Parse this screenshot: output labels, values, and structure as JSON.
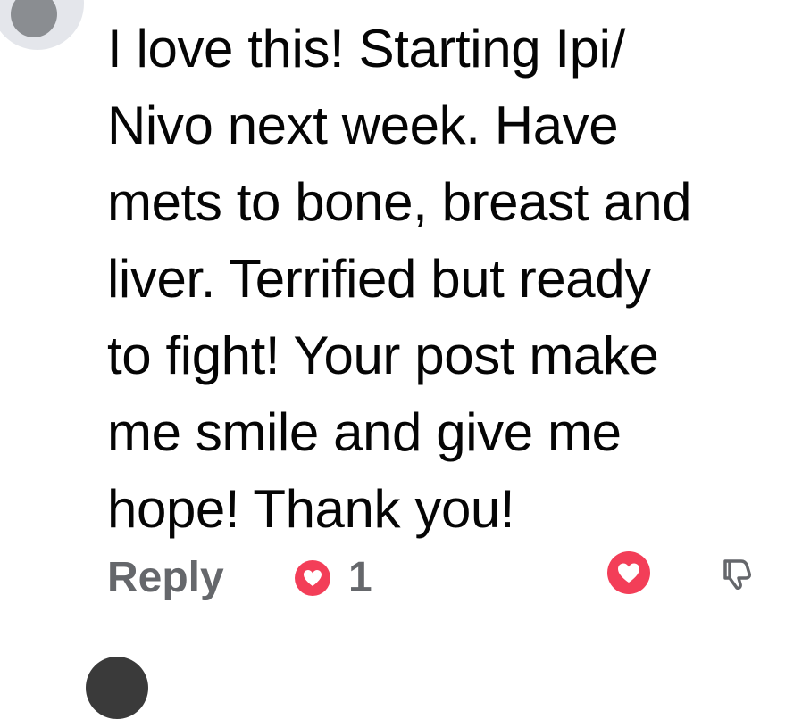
{
  "comment": {
    "text": "I love this! Starting Ipi/ Nivo next week. Have mets to bone, breast and liver. Terrified but ready to fight! Your post make me smile and give me hope! Thank you!",
    "lines": [
      "I love this! Starting Ipi/",
      "Nivo next week. Have",
      "mets to bone, breast and",
      "liver. Terrified but ready",
      "to fight! Your post make",
      "me smile and give me",
      "hope! Thank you!"
    ]
  },
  "actions": {
    "reply_label": "Reply",
    "reaction_icon": "heart-icon",
    "reaction_count": "1",
    "react_button_icon": "heart-icon",
    "dislike_button_icon": "thumbs-down-icon"
  },
  "colors": {
    "text": "#050505",
    "secondary": "#65676b",
    "heart": "#f33e58"
  }
}
